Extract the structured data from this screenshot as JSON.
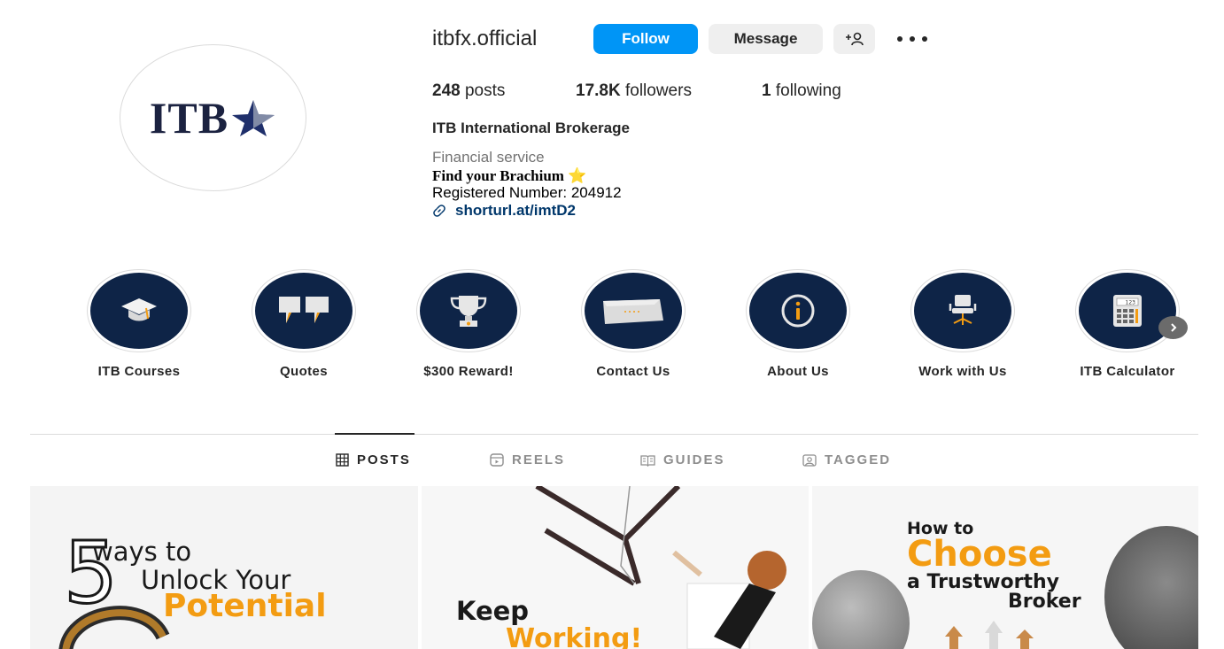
{
  "profile": {
    "username": "itbfx.official",
    "logo_text": "ITB",
    "follow_label": "Follow",
    "message_label": "Message",
    "stats": {
      "posts_count": "248",
      "posts_label": "posts",
      "followers_count": "17.8K",
      "followers_label": "followers",
      "following_count": "1",
      "following_label": "following"
    },
    "full_name": "ITB International Brokerage",
    "category": "Financial service",
    "tagline": "Find your Brachium ⭐",
    "registered": "Registered Number: 204912",
    "link": "shorturl.at/imtD2"
  },
  "highlights": [
    {
      "label": "ITB Courses",
      "icon": "graduation-cap-icon"
    },
    {
      "label": "Quotes",
      "icon": "quote-marks-icon"
    },
    {
      "label": "$300 Reward!",
      "icon": "trophy-icon"
    },
    {
      "label": "Contact Us",
      "icon": "envelope-icon"
    },
    {
      "label": "About Us",
      "icon": "info-icon"
    },
    {
      "label": "Work with Us",
      "icon": "office-chair-icon"
    },
    {
      "label": "ITB Calculator",
      "icon": "calculator-icon"
    }
  ],
  "tabs": [
    {
      "label": "POSTS",
      "active": true
    },
    {
      "label": "REELS",
      "active": false
    },
    {
      "label": "GUIDES",
      "active": false
    },
    {
      "label": "TAGGED",
      "active": false
    }
  ],
  "posts": [
    {
      "big_number": "5",
      "line1": "ways to",
      "line2": "Unlock Your",
      "line3": "Potential"
    },
    {
      "line1": "Keep",
      "line2": "Working!"
    },
    {
      "line1": "How to",
      "line2": "Choose",
      "line3": "a Trustworthy",
      "line4": "Broker"
    }
  ],
  "colors": {
    "accent": "#0095f6",
    "highlight_bg": "#0e2447",
    "orange": "#f39c12",
    "link": "#00376b"
  }
}
